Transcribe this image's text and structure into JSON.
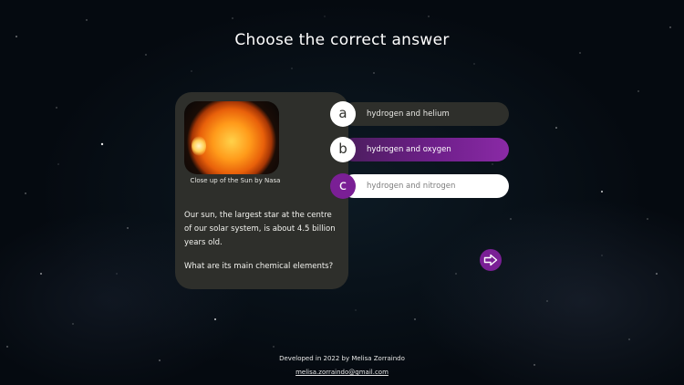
{
  "page": {
    "title": "Choose the correct answer"
  },
  "card": {
    "image_caption": "Close up of the Sun by Nasa",
    "fact": "Our sun, the largest star at the centre of our solar system, is about 4.5 billion years old.",
    "question": "What are its main chemical elements?"
  },
  "options": [
    {
      "letter": "a",
      "text": "hydrogen and helium",
      "state": "default"
    },
    {
      "letter": "b",
      "text": "hydrogen and oxygen",
      "state": "hover"
    },
    {
      "letter": "c",
      "text": "hydrogen and nitrogen",
      "state": "selected"
    }
  ],
  "next": {
    "icon": "arrow-right-icon"
  },
  "footer": {
    "credit": "Developed in 2022 by Melisa Zorraindo",
    "email": "melisa.zorraindo@gmail.com"
  },
  "colors": {
    "card_bg": "#2e2f2b",
    "accent_purple": "#7a1f95",
    "background": "#050a10"
  }
}
